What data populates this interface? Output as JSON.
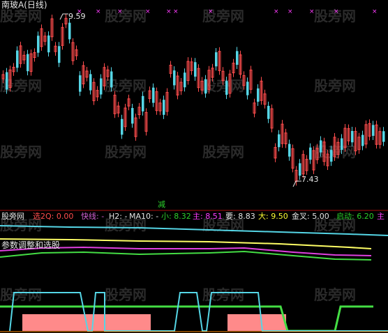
{
  "title": "南玻A(日线)",
  "watermark": "股旁网",
  "price_high_label": "9.59",
  "price_low_label": "7.43",
  "signal_label": "减",
  "sub_chart_label": "参数调整和选股",
  "header": [
    {
      "text": "股旁网",
      "color": "#e6e6e6"
    },
    {
      "text": "选2Q: 0.00",
      "color": "#ff4d4d"
    },
    {
      "text": "快线: -",
      "color": "#d060d0"
    },
    {
      "text": "H2: -",
      "color": "#e6e6e6"
    },
    {
      "text": "MA10: -",
      "color": "#e6e6e6"
    },
    {
      "text": "小: 8.32",
      "color": "#2cd12c"
    },
    {
      "text": "主: 8.51",
      "color": "#ff3dff"
    },
    {
      "text": "要: 8.83",
      "color": "#e6e6e6"
    },
    {
      "text": "大: 9.50",
      "color": "#ffff33"
    },
    {
      "text": "金叉: 5.00",
      "color": "#e6e6e6"
    },
    {
      "text": "启动: 6.20",
      "color": "#2cd12c"
    },
    {
      "text": "主",
      "color": "#ff3dff"
    }
  ],
  "colors": {
    "up": "#ff4d4d",
    "down": "#56d6e6",
    "grid": "#aa1111",
    "cyan": "#55d6e6",
    "yellow": "#ffff66",
    "magenta": "#e040e0",
    "green": "#44dd44",
    "pink": "#ff8a8a",
    "orange": "#ff8800"
  }
}
